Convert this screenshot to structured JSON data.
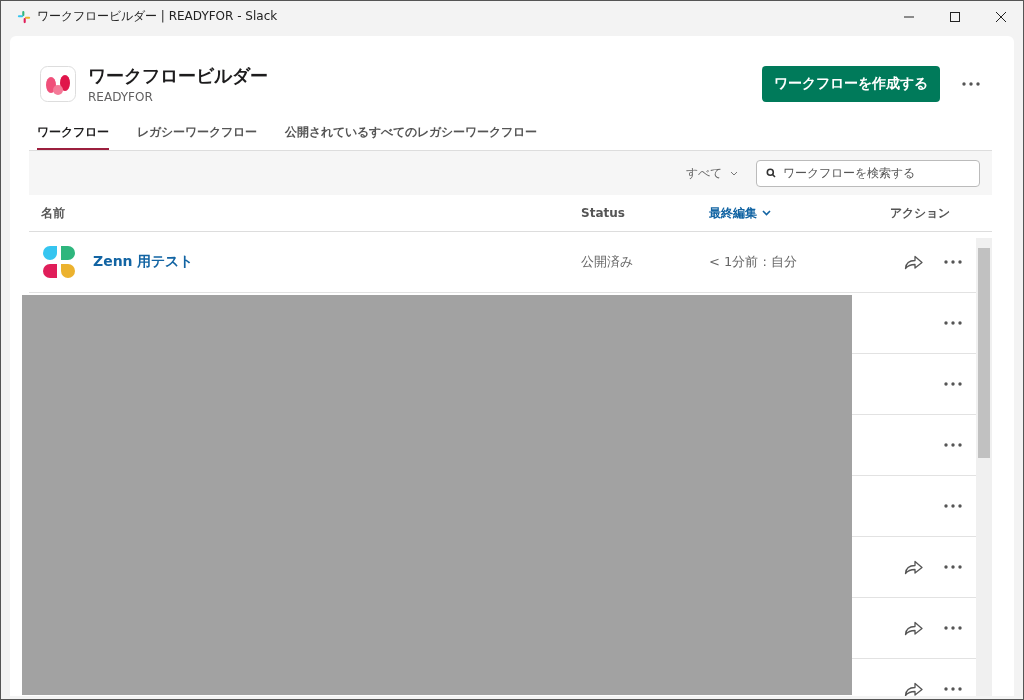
{
  "window": {
    "title": "ワークフロービルダー | READYFOR - Slack"
  },
  "header": {
    "title": "ワークフロービルダー",
    "workspace": "READYFOR",
    "create_button": "ワークフローを作成する"
  },
  "tabs": [
    {
      "label": "ワークフロー",
      "selected": true
    },
    {
      "label": "レガシーワークフロー",
      "selected": false
    },
    {
      "label": "公開されているすべてのレガシーワークフロー",
      "selected": false
    }
  ],
  "filter": {
    "value": "すべて"
  },
  "search": {
    "placeholder": "ワークフローを検索する"
  },
  "table": {
    "columns": [
      {
        "label": "名前",
        "sorted": false
      },
      {
        "label": "Status",
        "sorted": false
      },
      {
        "label": "最終編集",
        "sorted": true
      },
      {
        "label": "アクション",
        "sorted": false
      }
    ],
    "rows": [
      {
        "name": "Zenn 用テスト",
        "status": "公開済み",
        "edited": "< 1分前 : 自分",
        "shareable": true
      },
      {
        "shareable": false
      },
      {
        "shareable": false
      },
      {
        "shareable": false
      },
      {
        "shareable": false
      },
      {
        "shareable": true
      },
      {
        "shareable": true
      },
      {
        "shareable": true
      }
    ]
  },
  "redacted": true
}
